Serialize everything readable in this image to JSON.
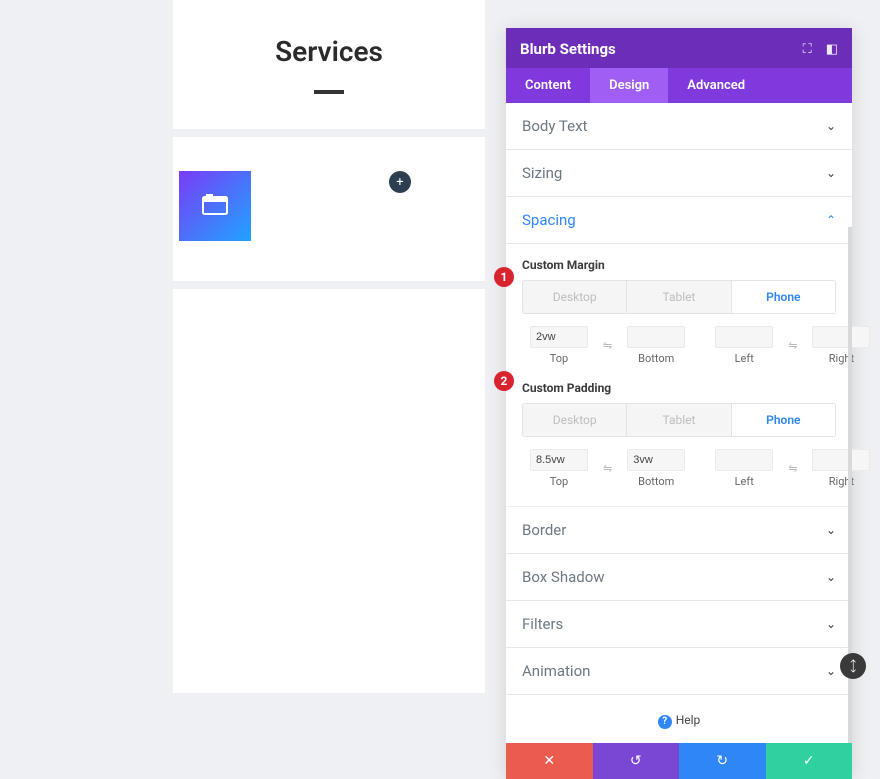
{
  "preview": {
    "title": "Services",
    "add_label": "+"
  },
  "panel": {
    "title": "Blurb Settings",
    "tabs": {
      "content": "Content",
      "design": "Design",
      "advanced": "Advanced"
    },
    "sections": {
      "body_text": "Body Text",
      "sizing": "Sizing",
      "spacing": "Spacing",
      "border": "Border",
      "box_shadow": "Box Shadow",
      "filters": "Filters",
      "animation": "Animation"
    },
    "spacing": {
      "margin_label": "Custom Margin",
      "padding_label": "Custom Padding",
      "devices": {
        "desktop": "Desktop",
        "tablet": "Tablet",
        "phone": "Phone"
      },
      "sides": {
        "top": "Top",
        "bottom": "Bottom",
        "left": "Left",
        "right": "Right"
      },
      "margin": {
        "top": "2vw",
        "bottom": "",
        "left": "",
        "right": ""
      },
      "padding": {
        "top": "8.5vw",
        "bottom": "3vw",
        "left": "",
        "right": ""
      }
    },
    "help": "Help",
    "badges": {
      "one": "1",
      "two": "2"
    }
  }
}
